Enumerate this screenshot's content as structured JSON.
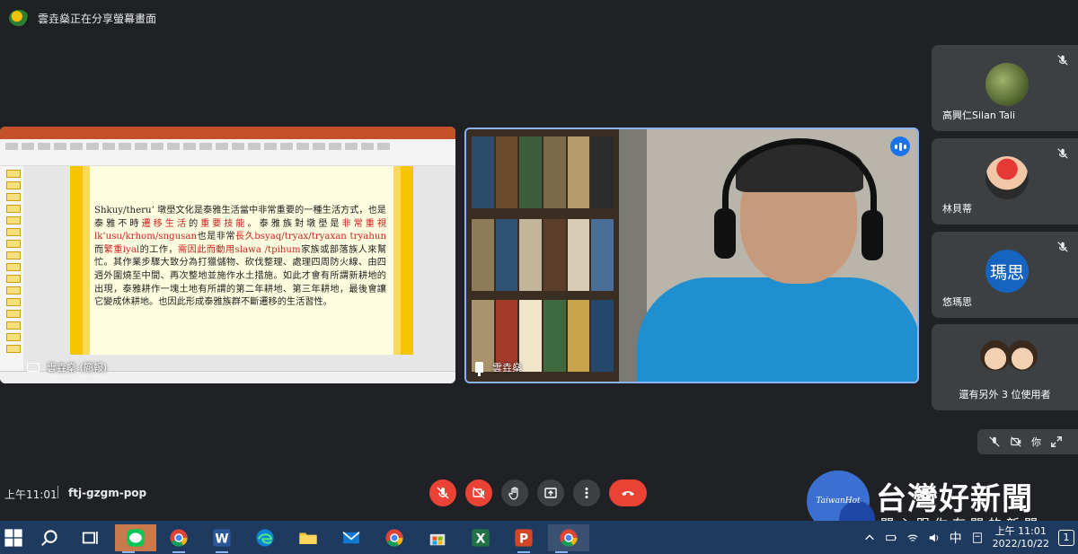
{
  "header": {
    "presenting_text": "雲垚燊正在分享螢幕畫面"
  },
  "presentation": {
    "presenter_label": "雲垚燊 (簡報)",
    "slide_segments": [
      {
        "t": "Shkuy/theru’ 墩壆文化是泰雅生活當中非常重要的一種生活方式，也是泰雅不時",
        "red": false
      },
      {
        "t": "遷移生活",
        "red": true
      },
      {
        "t": "的",
        "red": false
      },
      {
        "t": "重要技能",
        "red": true
      },
      {
        "t": "。泰雅族對墩壆是",
        "red": false
      },
      {
        "t": "非常重視lk’usu/krhom/sngusan",
        "red": true
      },
      {
        "t": "也是非常",
        "red": false
      },
      {
        "t": "長久bsyaq/tryax/tryaxan tryahun",
        "red": true
      },
      {
        "t": "而",
        "red": false
      },
      {
        "t": "繁重iyal",
        "red": true
      },
      {
        "t": "的工作，",
        "red": false
      },
      {
        "t": "需",
        "red": true
      },
      {
        "t": "因此而",
        "red": true
      },
      {
        "t": "動用slawa /tpihum",
        "red": true
      },
      {
        "t": "家族或部落族人來幫忙。其作業步驟大致分為打獵儲物、砍伐整理、處理四周防火線、由四週外圍燒至中間、再次整地並施作水土措施。如此才會有所謂新耕地的出現，泰雅耕作一塊土地有所謂的第二年耕地、第三年耕地，最後會讓它變成休耕地。也因此形成泰雅族群不斷遷移的生活習性。",
        "red": false
      }
    ]
  },
  "camera": {
    "name": "雲垚燊"
  },
  "participants": [
    {
      "name": "高興仁Silan Tali",
      "avatar": "photo-plant",
      "muted": true
    },
    {
      "name": "林貝蒂",
      "avatar": "photo-red-hat",
      "muted": true
    },
    {
      "name": "悠瑪思",
      "avatar_text": "瑪思",
      "avatar_color": "#1565c0",
      "muted": true
    },
    {
      "name": "還有另外 3 位使用者",
      "avatar": "photo-group"
    }
  ],
  "self_view": {
    "label": "你"
  },
  "meeting": {
    "time": "上午11:01",
    "code": "ftj-gzgm-pop"
  },
  "watermark": {
    "logo_text": "TaiwanHot",
    "title": "台灣好新聞",
    "subtitle": "關心跟你有關的新聞"
  },
  "taskbar": {
    "tray_lang": "中",
    "tray_time": "上午 11:01",
    "tray_date": "2022/10/22",
    "notification_count": "1"
  },
  "colors": {
    "accent": "#8ab4f8",
    "danger": "#ea4335",
    "bg": "#202124",
    "tile": "#3c4043"
  }
}
